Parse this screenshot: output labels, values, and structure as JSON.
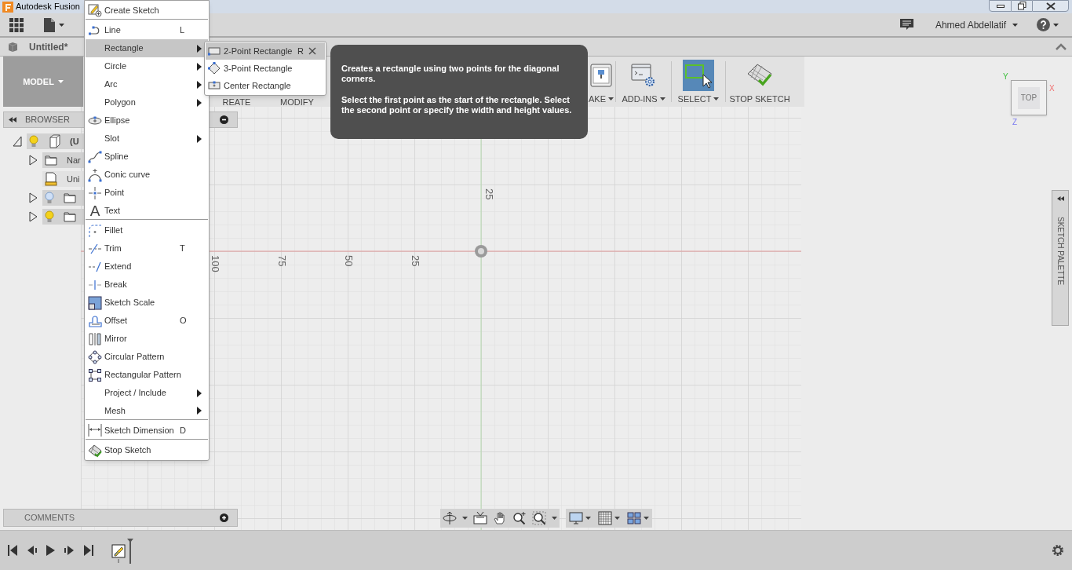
{
  "window": {
    "title": "Autodesk Fusion"
  },
  "account": {
    "user": "Ahmed Abdellatif"
  },
  "document": {
    "title": "Untitled*"
  },
  "workspace": {
    "label": "MODEL"
  },
  "ribbon": {
    "groups": [
      {
        "label": "REATE",
        "dropdown": false,
        "selected": false
      },
      {
        "label": "MODIFY",
        "dropdown": false,
        "selected": false
      },
      {
        "label": "AKE",
        "dropdown": true,
        "selected": false
      },
      {
        "label": "ADD-INS",
        "dropdown": true,
        "selected": false
      },
      {
        "label": "SELECT",
        "dropdown": true,
        "selected": true
      },
      {
        "label": "STOP SKETCH",
        "dropdown": false,
        "selected": false
      }
    ]
  },
  "browser": {
    "title": "BROWSER",
    "tree": [
      {
        "label": "(U",
        "kind": "component",
        "expanded": true,
        "visible": true,
        "children": [
          {
            "label": "Nar",
            "kind": "folder",
            "expanded": false
          },
          {
            "label": "Uni",
            "kind": "units"
          },
          {
            "kind": "folder",
            "expanded": false,
            "visible": false
          },
          {
            "kind": "folder",
            "expanded": false,
            "visible": true
          }
        ]
      }
    ]
  },
  "canvas": {
    "vertical_axis_labels": [
      "25"
    ],
    "horizontal_axis_labels": [
      "100",
      "75",
      "50",
      "25"
    ]
  },
  "view_cube": {
    "face": "TOP",
    "axes": [
      "Y",
      "X",
      "Z"
    ]
  },
  "sketch_palette": {
    "title": "SKETCH PALETTE"
  },
  "comments": {
    "title": "COMMENTS"
  },
  "create_menu": {
    "items": [
      {
        "label": "Create Sketch",
        "selected": false,
        "submenu": false,
        "divider_after": true
      },
      {
        "label": "Line",
        "shortcut": "L",
        "selected": false,
        "submenu": false,
        "divider_after": false
      },
      {
        "label": "Rectangle",
        "selected": true,
        "submenu": true,
        "divider_after": false
      },
      {
        "label": "Circle",
        "selected": false,
        "submenu": true,
        "divider_after": false
      },
      {
        "label": "Arc",
        "selected": false,
        "submenu": true,
        "divider_after": false
      },
      {
        "label": "Polygon",
        "selected": false,
        "submenu": true,
        "divider_after": false
      },
      {
        "label": "Ellipse",
        "selected": false,
        "submenu": false,
        "divider_after": false
      },
      {
        "label": "Slot",
        "selected": false,
        "submenu": true,
        "divider_after": false
      },
      {
        "label": "Spline",
        "selected": false,
        "submenu": false,
        "divider_after": false
      },
      {
        "label": "Conic curve",
        "selected": false,
        "submenu": false,
        "divider_after": false
      },
      {
        "label": "Point",
        "selected": false,
        "submenu": false,
        "divider_after": false
      },
      {
        "label": "Text",
        "glyph": "A",
        "selected": false,
        "submenu": false,
        "divider_after": true
      },
      {
        "label": "Fillet",
        "selected": false,
        "submenu": false,
        "divider_after": false
      },
      {
        "label": "Trim",
        "shortcut": "T",
        "selected": false,
        "submenu": false,
        "divider_after": false
      },
      {
        "label": "Extend",
        "selected": false,
        "submenu": false,
        "divider_after": false
      },
      {
        "label": "Break",
        "selected": false,
        "submenu": false,
        "divider_after": false
      },
      {
        "label": "Sketch Scale",
        "selected": false,
        "submenu": false,
        "divider_after": false
      },
      {
        "label": "Offset",
        "shortcut": "O",
        "selected": false,
        "submenu": false,
        "divider_after": false
      },
      {
        "label": "Mirror",
        "selected": false,
        "submenu": false,
        "divider_after": false
      },
      {
        "label": "Circular Pattern",
        "selected": false,
        "submenu": false,
        "divider_after": false
      },
      {
        "label": "Rectangular Pattern",
        "selected": false,
        "submenu": false,
        "divider_after": false
      },
      {
        "label": "Project / Include",
        "selected": false,
        "submenu": true,
        "divider_after": false
      },
      {
        "label": "Mesh",
        "selected": false,
        "submenu": true,
        "divider_after": true
      },
      {
        "label": "Sketch Dimension",
        "shortcut": "D",
        "selected": false,
        "submenu": false,
        "divider_after": true
      },
      {
        "label": "Stop Sketch",
        "selected": false,
        "submenu": false,
        "divider_after": false
      }
    ]
  },
  "rectangle_submenu": {
    "items": [
      {
        "label": "2-Point Rectangle",
        "shortcut": "R",
        "selected": true
      },
      {
        "label": "3-Point Rectangle",
        "selected": false
      },
      {
        "label": "Center Rectangle",
        "selected": false
      }
    ]
  },
  "tooltip": {
    "paragraphs": [
      "Creates a rectangle using two points for the diagonal corners.",
      "Select the first point as the start of the rectangle. Select the second point or specify the width and height values."
    ]
  }
}
